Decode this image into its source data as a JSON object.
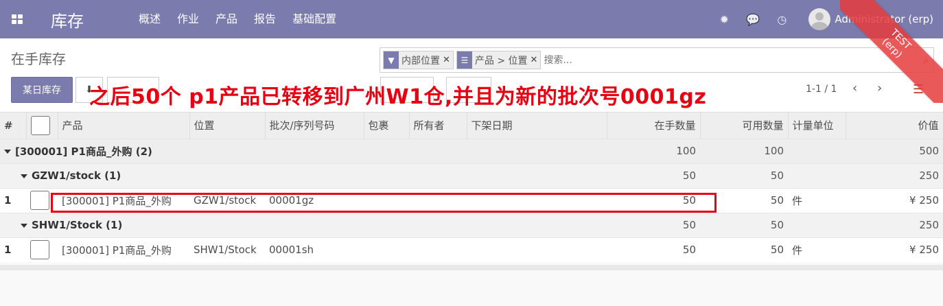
{
  "navbar": {
    "app_name": "库存",
    "menu": [
      "概述",
      "作业",
      "产品",
      "报告",
      "基础配置"
    ],
    "user_name": "Administrator (erp)"
  },
  "ribbon": {
    "line1": "TEST",
    "line2": "(erp)"
  },
  "control_panel": {
    "breadcrumb": "在手库存",
    "primary_button": "某日库存",
    "search": {
      "facets": [
        {
          "icon": "filter-icon",
          "label": "内部位置"
        },
        {
          "icon": "group-by-icon",
          "label": "产品 > 位置"
        }
      ],
      "placeholder": "搜索..."
    },
    "pager": "1-1 / 1"
  },
  "annotation": "之后50个 p1产品已转移到广州W1仓,并且为新的批次号0001gz",
  "table": {
    "headers": {
      "index": "#",
      "product": "产品",
      "location": "位置",
      "lot": "批次/序列号码",
      "package": "包裹",
      "owner": "所有者",
      "removal_date": "下架日期",
      "on_hand": "在手数量",
      "available": "可用数量",
      "uom": "计量单位",
      "value": "价值"
    },
    "groups": {
      "g1_label": "[300001] P1商品_外购 (2)",
      "g1_on_hand": "100",
      "g1_available": "100",
      "g1_value": "500",
      "g2_label": "GZW1/stock (1)",
      "g2_on_hand": "50",
      "g2_available": "50",
      "g2_value": "250",
      "g3_label": "SHW1/Stock (1)",
      "g3_on_hand": "50",
      "g3_available": "50",
      "g3_value": "250"
    },
    "rows": [
      {
        "index": "1",
        "product": "[300001] P1商品_外购",
        "location": "GZW1/stock",
        "lot": "00001gz",
        "on_hand": "50",
        "available": "50",
        "uom": "件",
        "value": "¥ 250"
      },
      {
        "index": "1",
        "product": "[300001] P1商品_外购",
        "location": "SHW1/Stock",
        "lot": "00001sh",
        "on_hand": "50",
        "available": "50",
        "uom": "件",
        "value": "¥ 250"
      }
    ]
  }
}
